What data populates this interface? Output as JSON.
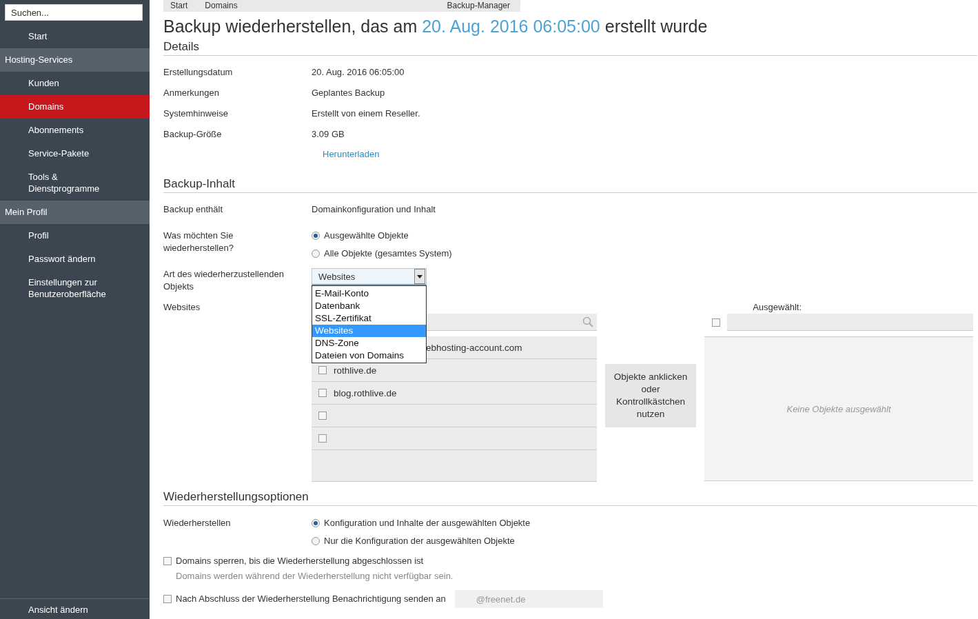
{
  "sidebar": {
    "search": {
      "placeholder": "Suchen..."
    },
    "top_items": [
      {
        "label": "Start",
        "selected": false
      }
    ],
    "groups": [
      {
        "title": "Hosting-Services",
        "items": [
          {
            "label": "Kunden",
            "selected": false
          },
          {
            "label": "Domains",
            "selected": true
          },
          {
            "label": "Abonnements",
            "selected": false
          },
          {
            "label": "Service-Pakete",
            "selected": false
          },
          {
            "label": "Tools & Dienstprogramme",
            "selected": false
          }
        ]
      },
      {
        "title": "Mein Profil",
        "items": [
          {
            "label": "Profil",
            "selected": false
          },
          {
            "label": "Passwort ändern",
            "selected": false
          },
          {
            "label": "Einstellungen zur Benutzeroberfläche",
            "selected": false
          }
        ]
      }
    ],
    "footer": "Ansicht ändern"
  },
  "breadcrumbs": [
    {
      "label": "Start"
    },
    {
      "label": "Domains"
    },
    {
      "label": "Backup-Manager"
    }
  ],
  "title": {
    "prefix": "Backup wiederherstellen, das am",
    "date": "20. Aug. 2016 06:05:00",
    "suffix": "erstellt wurde"
  },
  "details": {
    "heading": "Details",
    "rows": [
      {
        "label": "Erstellungsdatum",
        "value": "20. Aug. 2016 06:05:00"
      },
      {
        "label": "Anmerkungen",
        "value": "Geplantes Backup"
      },
      {
        "label": "Systemhinweise",
        "value": "Erstellt von einem Reseller."
      },
      {
        "label": "Backup-Größe",
        "value": "3.09 GB"
      }
    ],
    "download_link": "Herunterladen"
  },
  "content": {
    "heading": "Backup-Inhalt",
    "contains_label": "Backup enthält",
    "contains_value": "Domainkonfiguration und Inhalt",
    "restore_label": "Was möchten Sie wiederherstellen?",
    "restore_options": [
      {
        "label": "Ausgewählte Objekte",
        "selected": true
      },
      {
        "label": "Alle Objekte (gesamtes System)",
        "selected": false
      }
    ],
    "type_label": "Art des wiederherzustellenden Objekts",
    "type_select": {
      "value": "Websites",
      "expanded": true,
      "options": [
        {
          "label": "E-Mail-Konto",
          "selected": false
        },
        {
          "label": "Datenbank",
          "selected": false
        },
        {
          "label": "SSL-Zertifikat",
          "selected": false
        },
        {
          "label": "Websites",
          "selected": true
        },
        {
          "label": "DNS-Zone",
          "selected": false
        },
        {
          "label": "Dateien von Domains",
          "selected": false
        }
      ]
    },
    "objects_label": "Websites",
    "available": {
      "rows": [
        {
          "kind": "covered",
          "label": "ebhosting-account.com"
        },
        {
          "kind": "item",
          "label": "rothlive.de",
          "checked": false
        },
        {
          "kind": "item",
          "label": "blog.rothlive.de",
          "checked": false
        },
        {
          "kind": "item",
          "checked": false
        },
        {
          "kind": "item",
          "checked": false
        }
      ]
    },
    "hint": "Objekte anklicken oder Kontrollkästchen nutzen",
    "selected_panel": {
      "title": "Ausgewählt:",
      "select_all_checked": false,
      "empty": "Keine Objekte ausgewählt"
    }
  },
  "options": {
    "heading": "Wiederherstellungsoptionen",
    "restore_label": "Wiederherstellen",
    "restore_options": [
      {
        "label": "Konfiguration und Inhalte der ausgewählten Objekte",
        "selected": true
      },
      {
        "label": "Nur die Konfiguration der ausgewählten Objekte",
        "selected": false
      }
    ],
    "lock": {
      "label": "Domains sperren, bis die Wiederherstellung abgeschlossen ist",
      "checked": false,
      "note": "Domains werden während der Wiederherstellung nicht verfügbar sein."
    },
    "notify": {
      "label": "Nach Abschluss der Wiederherstellung Benachrichtigung senden an",
      "checked": false,
      "value": "@freenet.de",
      "disabled": true
    }
  }
}
